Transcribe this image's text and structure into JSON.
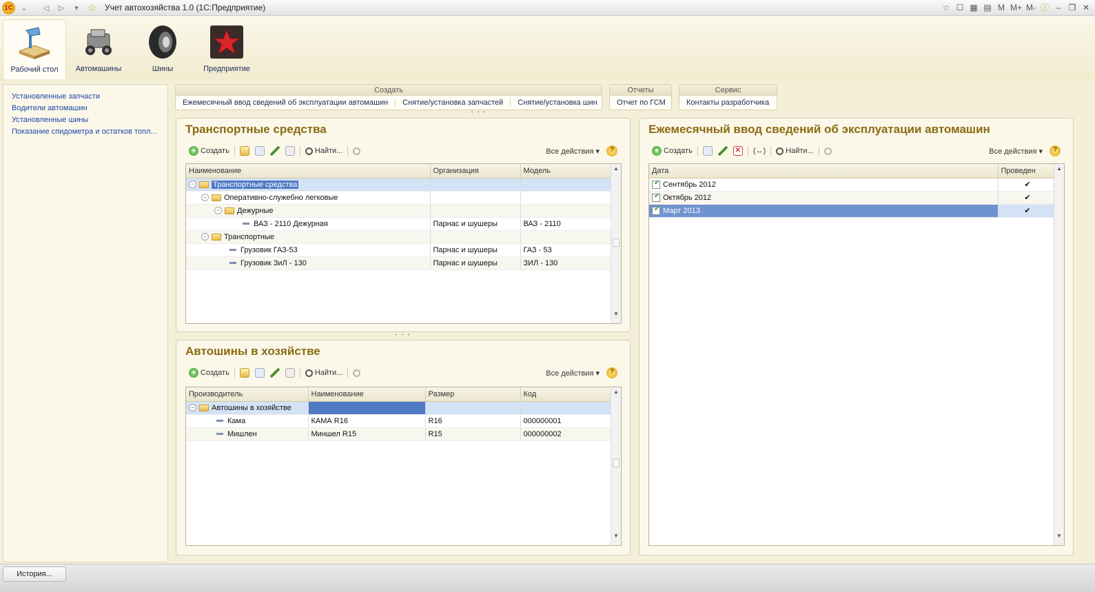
{
  "app": {
    "title": "Учет автохозяйства 1.0 (1С:Предприятие)",
    "logo": "1С"
  },
  "titlebar_right": [
    "M",
    "M+",
    "M-"
  ],
  "sections": [
    {
      "label": "Рабочий стол",
      "icon": "desk-icon"
    },
    {
      "label": "Автомашины",
      "icon": "car-icon"
    },
    {
      "label": "Шины",
      "icon": "tire-icon"
    },
    {
      "label": "Предприятие",
      "icon": "enterprise-star-icon"
    }
  ],
  "leftnav": [
    "Установленные запчасти",
    "Водители автомашин",
    "Установленные шины",
    "Показание спидометра и остатков топл..."
  ],
  "commands": {
    "create": {
      "title": "Создать",
      "items": [
        "Ежемесячный ввод сведений об эксплуатации автомашин",
        "Снятие/установка запчастей",
        "Снятие/установка шин"
      ]
    },
    "reports": {
      "title": "Отчеты",
      "items": [
        "Отчет по ГСМ"
      ]
    },
    "service": {
      "title": "Сервис",
      "items": [
        "Контакты разработчика"
      ]
    }
  },
  "toolbar": {
    "create": "Создать",
    "find": "Найти...",
    "all_actions": "Все действия ▾",
    "help": "?"
  },
  "vehicles": {
    "title": "Транспортные средства",
    "columns": [
      "Наименование",
      "Организация",
      "Модель"
    ],
    "rows": [
      {
        "name": "Транспортные средства",
        "org": "",
        "model": ""
      },
      {
        "name": "Оперативно-служебно легковые",
        "org": "",
        "model": ""
      },
      {
        "name": "Дежурные",
        "org": "",
        "model": ""
      },
      {
        "name": "ВАЗ - 2110 Дежурная",
        "org": "Парнас и шушеры",
        "model": "ВАЗ - 2110"
      },
      {
        "name": "Транспортные",
        "org": "",
        "model": ""
      },
      {
        "name": "Грузовик ГАЗ-53",
        "org": "Парнас и шушеры",
        "model": "ГАЗ - 53"
      },
      {
        "name": "Грузовик ЗиЛ - 130",
        "org": "Парнас и шушеры",
        "model": "ЗИЛ - 130"
      }
    ]
  },
  "tires": {
    "title": "Автошины в хозяйстве",
    "columns": [
      "Производитель",
      "Наименование",
      "Размер",
      "Код"
    ],
    "rows": [
      {
        "maker": "Автошины в хозяйстве",
        "name": "",
        "size": "",
        "code": ""
      },
      {
        "maker": "Кама",
        "name": "КАМА R16",
        "size": "R16",
        "code": "000000001"
      },
      {
        "maker": "Мишлен",
        "name": "Миншел R15",
        "size": "R15",
        "code": "000000002"
      }
    ]
  },
  "monthly": {
    "title": "Ежемесячный ввод сведений об эксплуатации автомашин",
    "columns": [
      "Дата",
      "Проведен"
    ],
    "rows": [
      {
        "date": "Сентябрь 2012",
        "posted": "✔"
      },
      {
        "date": "Октябрь 2012",
        "posted": "✔"
      },
      {
        "date": "Март 2013",
        "posted": "✔"
      }
    ]
  },
  "statusbar": {
    "history": "История..."
  }
}
